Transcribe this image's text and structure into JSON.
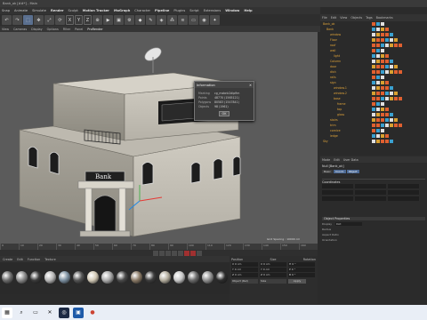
{
  "window": {
    "title": "Bank_ok [##*] - Main"
  },
  "menu": [
    "Snap",
    "Animate",
    "Simulate",
    "Render",
    "Sculpt",
    "Motion Tracker",
    "MoGraph",
    "Character",
    "Pipeline",
    "Plugins",
    "Script",
    "Extensions",
    "Window",
    "Help"
  ],
  "view_menu": [
    "View",
    "Cameras",
    "Display",
    "Options",
    "Filter",
    "Panel",
    "ProRender"
  ],
  "toolbar": {
    "x": "X",
    "y": "Y",
    "z": "Z"
  },
  "object_manager": {
    "tabs": [
      "File",
      "Edit",
      "View",
      "Objects",
      "Tags",
      "Bookmarks"
    ],
    "items": [
      "Bank_ok",
      "Bank",
      "window",
      "Floor",
      "roof",
      "wall",
      "light",
      "Column",
      "door",
      "dish",
      "rails",
      "sign",
      "window.1",
      "window.2",
      "base",
      "frame",
      "top",
      "glass",
      "stairs",
      "trim",
      "cornice",
      "ledge",
      "Sky"
    ]
  },
  "attributes": {
    "tabs": [
      "Mode",
      "Edit",
      "User Data"
    ],
    "title": "Null [Bank_ok]",
    "subtabs": [
      "Basic",
      "Coord.",
      "Object"
    ],
    "coord_label": "Coordinates",
    "obj_section": "Object Properties",
    "display_label": "Display",
    "display_value": "Dot",
    "radius_label": "Radius",
    "aspect_label": "Aspect Ratio",
    "orientation_label": "Orientation"
  },
  "viewport": {
    "sign_text": "Bank",
    "grid_spacing": "Grid Spacing : 10000 cm"
  },
  "dialog": {
    "title": "Information",
    "rows": [
      {
        "k": "Marking",
        "v": "cg_mxbnk2dipfim"
      },
      {
        "k": "Points",
        "v": "48770 (1565121)"
      },
      {
        "k": "Polygons",
        "v": "80583 (1547841)"
      },
      {
        "k": "Objects",
        "v": "98 (1961)"
      }
    ],
    "ok": "OK"
  },
  "timeline": {
    "ticks": [
      "0",
      "10",
      "20",
      "30",
      "40",
      "50",
      "60",
      "70",
      "80",
      "90",
      "100",
      "110",
      "120",
      "130",
      "140",
      "150",
      "160"
    ]
  },
  "material_menu": [
    "Create",
    "Edit",
    "Function",
    "Texture"
  ],
  "materials": [
    "#6c6c6c",
    "#8a8a8a",
    "#3a3a3a",
    "#b7b7b7",
    "#7b8fa0",
    "#555555",
    "#d2c9b6",
    "#a9a9a9",
    "#494949",
    "#8a7a66",
    "#3c3c3c",
    "#b3ad9e",
    "#c8c8c8",
    "#6a6a6a",
    "#909090",
    "#2c2c2c"
  ],
  "coordinates": {
    "headers": [
      "Position",
      "Size",
      "Rotation"
    ],
    "rows": [
      [
        "X  0 cm",
        "X  0 cm",
        "H  0 °"
      ],
      [
        "Y  0 cm",
        "Y  0 cm",
        "P  0 °"
      ],
      [
        "Z  0 cm",
        "Z  0 cm",
        "B  0 °"
      ]
    ],
    "mode": "Object (Rel)",
    "size_mode": "Size",
    "apply": "Apply"
  },
  "colors": {
    "accent": "#4d6a95",
    "object_name": "#e0a43a",
    "viewport": "#5b5b5b"
  }
}
